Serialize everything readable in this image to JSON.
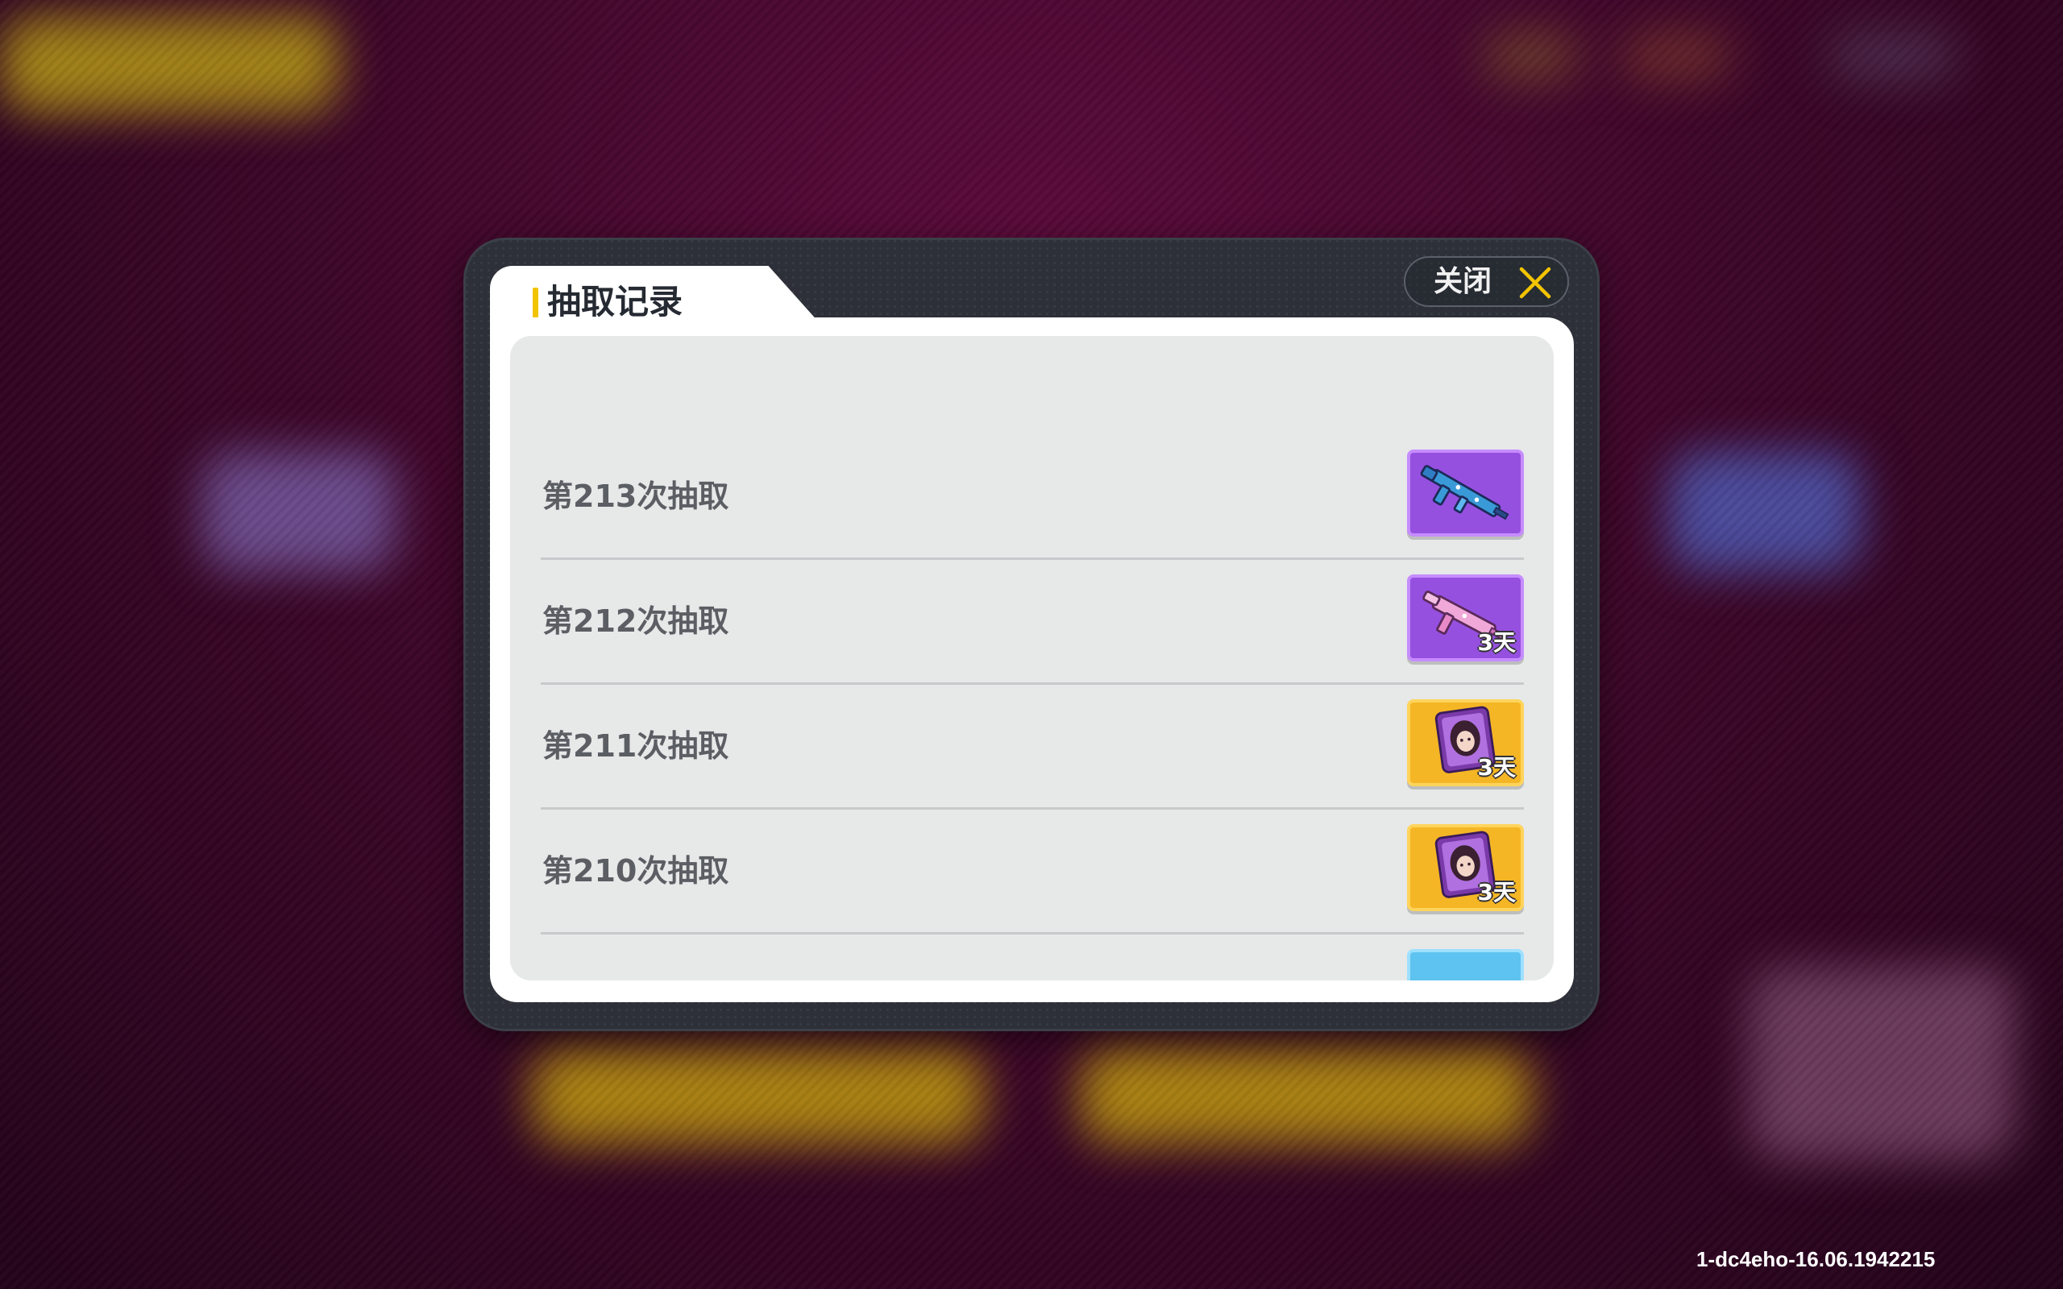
{
  "dialog": {
    "title": "抽取记录",
    "close_label": "关闭"
  },
  "records": [
    {
      "label": "第213次抽取",
      "reward_icon": "blue-rifle-icon",
      "reward_color": "purple",
      "duration": ""
    },
    {
      "label": "第212次抽取",
      "reward_icon": "pink-smg-icon",
      "reward_color": "purple",
      "duration": "3天"
    },
    {
      "label": "第211次抽取",
      "reward_icon": "character-avatar-frame-icon",
      "reward_color": "gold",
      "duration": "3天"
    },
    {
      "label": "第210次抽取",
      "reward_icon": "character-avatar-frame-icon",
      "reward_color": "gold",
      "duration": "3天"
    }
  ],
  "watermark": "1-dc4eho-16.06.1942215",
  "colors": {
    "accent": "#f2c400",
    "purple_rarity": "#9650e0",
    "gold_rarity": "#f5b625",
    "blue_rarity": "#5ec3f0"
  }
}
